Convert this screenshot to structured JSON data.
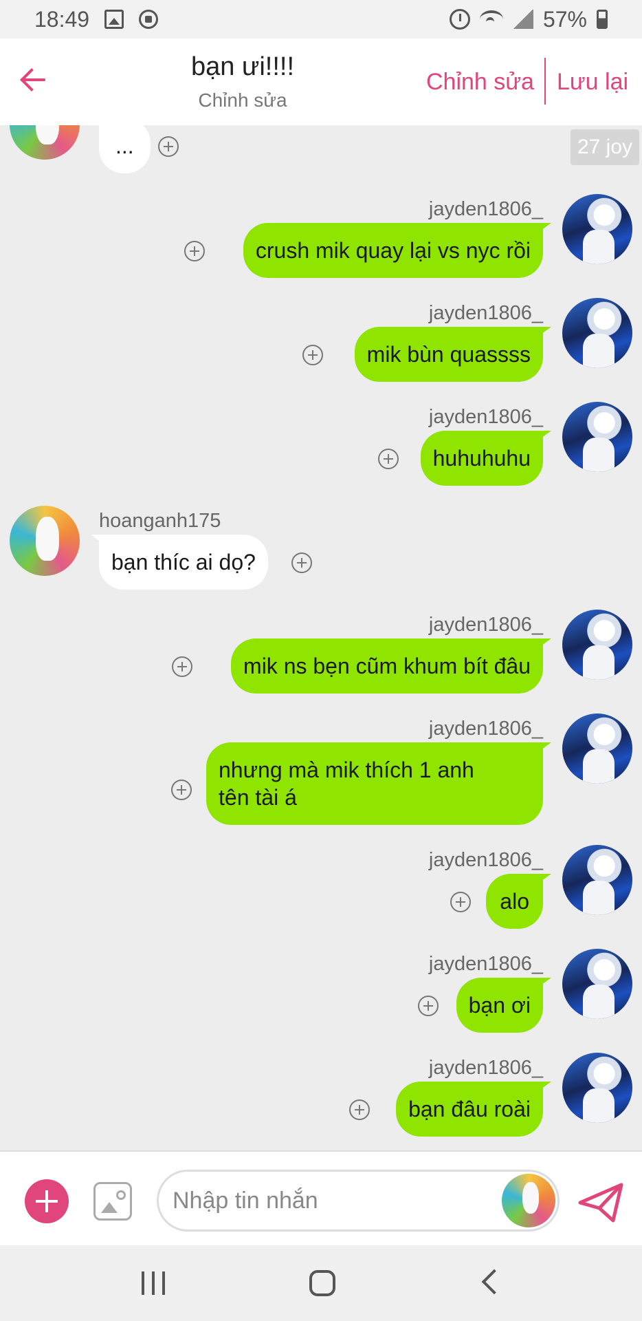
{
  "status_bar": {
    "time": "18:49",
    "battery": "57%"
  },
  "header": {
    "title": "bạn ưi!!!!",
    "subtitle": "Chỉnh sửa",
    "edit_label": "Chỉnh sửa",
    "save_label": "Lưu lại"
  },
  "chat": {
    "joy_badge": "27 joy",
    "messages": [
      {
        "side": "them",
        "sender": "",
        "text": "..."
      },
      {
        "side": "me",
        "sender": "jayden1806_",
        "text": "crush mik quay lại vs nyc rồi"
      },
      {
        "side": "me",
        "sender": "jayden1806_",
        "text": "mik bùn quassss"
      },
      {
        "side": "me",
        "sender": "jayden1806_",
        "text": "huhuhuhu"
      },
      {
        "side": "them",
        "sender": "hoanganh175",
        "text": "bạn thíc ai dọ?"
      },
      {
        "side": "me",
        "sender": "jayden1806_",
        "text": "mik ns bẹn cũm khum bít đâu"
      },
      {
        "side": "me",
        "sender": "jayden1806_",
        "text": "nhưng mà mik thích 1 anh\ntên tài á"
      },
      {
        "side": "me",
        "sender": "jayden1806_",
        "text": "alo"
      },
      {
        "side": "me",
        "sender": "jayden1806_",
        "text": "bạn ơi"
      },
      {
        "side": "me",
        "sender": "jayden1806_",
        "text": "bạn đâu roài"
      }
    ]
  },
  "input_bar": {
    "placeholder": "Nhập tin nhắn",
    "value": ""
  },
  "icons": {
    "back": "arrow-left-icon",
    "add": "plus-icon",
    "image": "image-icon",
    "send": "paper-plane-icon",
    "reaction": "add-reaction-icon"
  },
  "colors": {
    "accent": "#e0457b",
    "my_bubble": "#8fe400",
    "their_bubble": "#ffffff",
    "background": "#ededed"
  }
}
